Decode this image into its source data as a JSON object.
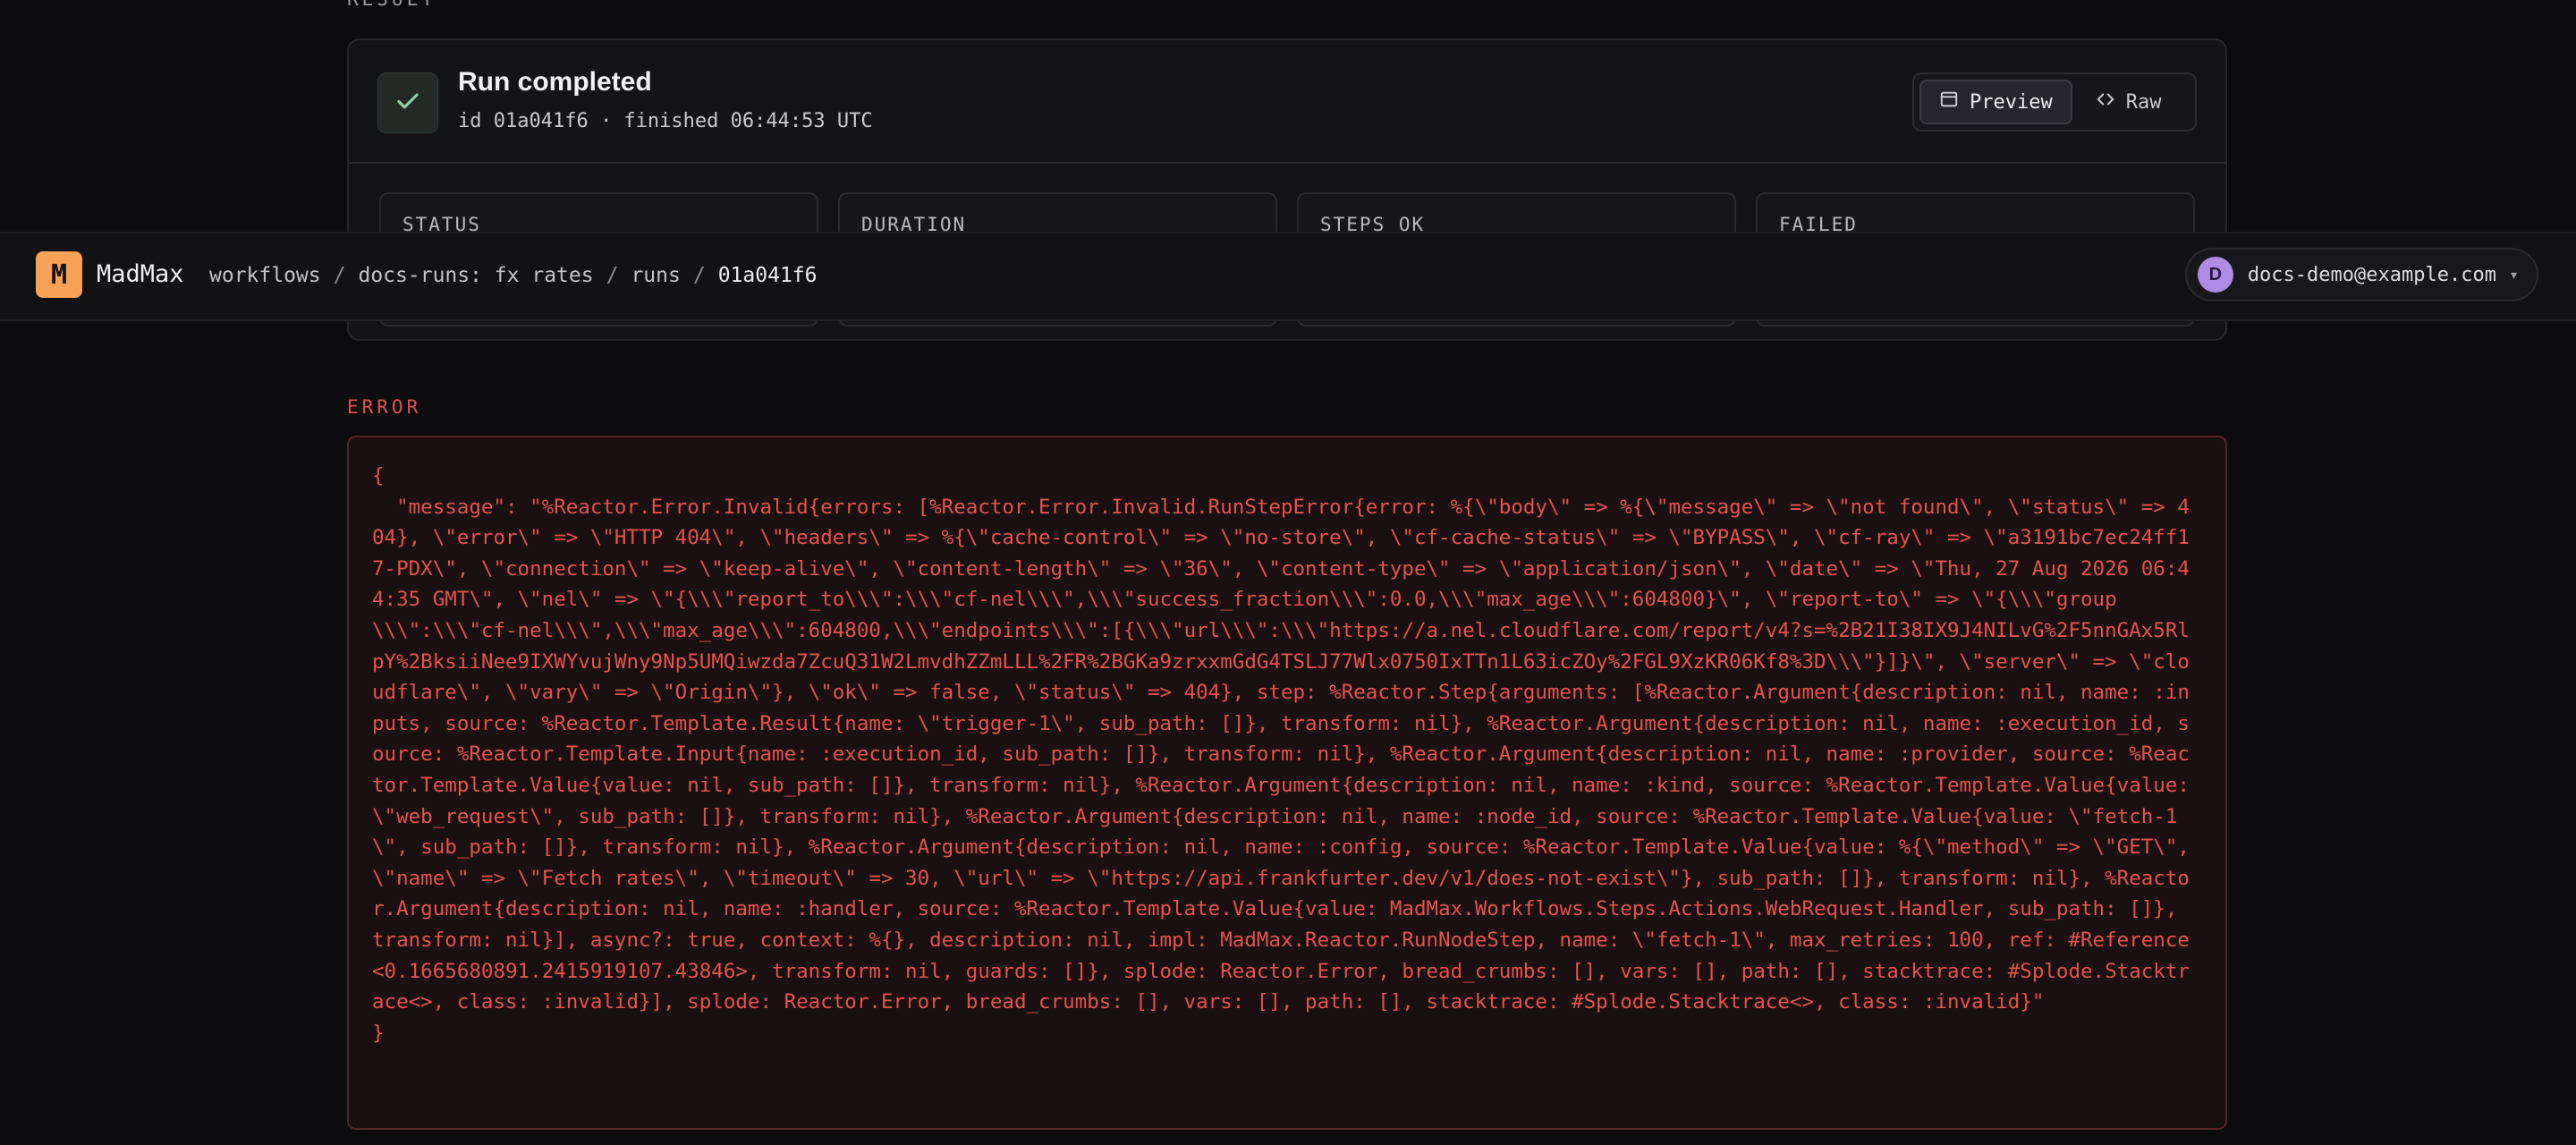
{
  "app": {
    "brand_letter": "M",
    "brand_name": "MadMax",
    "accent_color": "#f7a256"
  },
  "breadcrumb": {
    "items": [
      "workflows",
      "docs-runs: fx rates",
      "runs",
      "01a041f6"
    ],
    "separator": "/"
  },
  "user": {
    "initial": "D",
    "email": "docs-demo@example.com",
    "caret": "▾"
  },
  "result": {
    "heading": "RESULT",
    "title": "Run completed",
    "subtitle": "id 01a041f6 · finished 06:44:53 UTC",
    "status_icon": "check-icon",
    "view_toggle": {
      "preview_label": "Preview",
      "raw_label": "Raw",
      "selected": "Preview"
    },
    "stats": [
      {
        "label": "STATUS"
      },
      {
        "label": "DURATION"
      },
      {
        "label": "STEPS OK"
      },
      {
        "label": "FAILED"
      }
    ]
  },
  "error": {
    "heading": "ERROR",
    "text": "{\n  \"message\": \"%Reactor.Error.Invalid{errors: [%Reactor.Error.Invalid.RunStepError{error: %{\\\"body\\\" => %{\\\"message\\\" => \\\"not found\\\", \\\"status\\\" => 404}, \\\"error\\\" => \\\"HTTP 404\\\", \\\"headers\\\" => %{\\\"cache-control\\\" => \\\"no-store\\\", \\\"cf-cache-status\\\" => \\\"BYPASS\\\", \\\"cf-ray\\\" => \\\"a3191bc7ec24ff17-PDX\\\", \\\"connection\\\" => \\\"keep-alive\\\", \\\"content-length\\\" => \\\"36\\\", \\\"content-type\\\" => \\\"application/json\\\", \\\"date\\\" => \\\"Thu, 27 Aug 2026 06:44:35 GMT\\\", \\\"nel\\\" => \\\"{\\\\\\\"report_to\\\\\\\":\\\\\\\"cf-nel\\\\\\\",\\\\\\\"success_fraction\\\\\\\":0.0,\\\\\\\"max_age\\\\\\\":604800}\\\", \\\"report-to\\\" => \\\"{\\\\\\\"group\\\\\\\":\\\\\\\"cf-nel\\\\\\\",\\\\\\\"max_age\\\\\\\":604800,\\\\\\\"endpoints\\\\\\\":[{\\\\\\\"url\\\\\\\":\\\\\\\"https://a.nel.cloudflare.com/report/v4?s=%2B21I38IX9J4NILvG%2F5nnGAx5RlpY%2BksiiNee9IXWYvujWny9Np5UMQiwzda7ZcuQ31W2LmvdhZZmLLL%2FR%2BGKa9zrxxmGdG4TSLJ77Wlx0750IxTTn1L63icZOy%2FGL9XzKR06Kf8%3D\\\\\\\"}]}\\\", \\\"server\\\" => \\\"cloudflare\\\", \\\"vary\\\" => \\\"Origin\\\"}, \\\"ok\\\" => false, \\\"status\\\" => 404}, step: %Reactor.Step{arguments: [%Reactor.Argument{description: nil, name: :inputs, source: %Reactor.Template.Result{name: \\\"trigger-1\\\", sub_path: []}, transform: nil}, %Reactor.Argument{description: nil, name: :execution_id, source: %Reactor.Template.Input{name: :execution_id, sub_path: []}, transform: nil}, %Reactor.Argument{description: nil, name: :provider, source: %Reactor.Template.Value{value: nil, sub_path: []}, transform: nil}, %Reactor.Argument{description: nil, name: :kind, source: %Reactor.Template.Value{value: \\\"web_request\\\", sub_path: []}, transform: nil}, %Reactor.Argument{description: nil, name: :node_id, source: %Reactor.Template.Value{value: \\\"fetch-1\\\", sub_path: []}, transform: nil}, %Reactor.Argument{description: nil, name: :config, source: %Reactor.Template.Value{value: %{\\\"method\\\" => \\\"GET\\\", \\\"name\\\" => \\\"Fetch rates\\\", \\\"timeout\\\" => 30, \\\"url\\\" => \\\"https://api.frankfurter.dev/v1/does-not-exist\\\"}, sub_path: []}, transform: nil}, %Reactor.Argument{description: nil, name: :handler, source: %Reactor.Template.Value{value: MadMax.Workflows.Steps.Actions.WebRequest.Handler, sub_path: []}, transform: nil}], async?: true, context: %{}, description: nil, impl: MadMax.Reactor.RunNodeStep, name: \\\"fetch-1\\\", max_retries: 100, ref: #Reference<0.1665680891.2415919107.43846>, transform: nil, guards: []}, splode: Reactor.Error, bread_crumbs: [], vars: [], path: [], stacktrace: #Splode.Stacktrace<>, class: :invalid}], splode: Reactor.Error, bread_crumbs: [], vars: [], path: [], stacktrace: #Splode.Stacktrace<>, class: :invalid}\"\n}"
  }
}
